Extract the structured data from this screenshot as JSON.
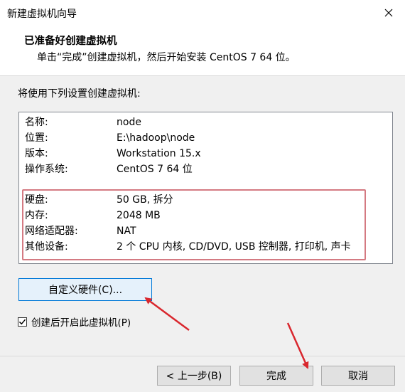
{
  "window": {
    "title": "新建虚拟机向导",
    "close_icon": "close-icon"
  },
  "header": {
    "title": "已准备好创建虚拟机",
    "subtitle": "单击“完成”创建虚拟机，然后开始安装 CentOS 7 64 位。"
  },
  "intro": "将使用下列设置创建虚拟机:",
  "summary": {
    "general": [
      {
        "key": "名称:",
        "value": "node"
      },
      {
        "key": "位置:",
        "value": "E:\\hadoop\\node"
      },
      {
        "key": "版本:",
        "value": "Workstation 15.x"
      },
      {
        "key": "操作系统:",
        "value": "CentOS 7 64 位"
      }
    ],
    "hardware": [
      {
        "key": "硬盘:",
        "value": "50 GB, 拆分"
      },
      {
        "key": "内存:",
        "value": "2048 MB"
      },
      {
        "key": "网络适配器:",
        "value": "NAT"
      },
      {
        "key": "其他设备:",
        "value": "2 个 CPU 内核, CD/DVD, USB 控制器, 打印机, 声卡"
      }
    ]
  },
  "customize_button": "自定义硬件(C)...",
  "power_on": {
    "label": "创建后开启此虚拟机(P)",
    "checked": true
  },
  "footer": {
    "back_label": "< 上一步(B)",
    "finish_label": "完成",
    "cancel_label": "取消"
  },
  "colors": {
    "annotation": "#d9272e",
    "highlight_border": "#d47a82",
    "focus_border": "#0078d7"
  }
}
